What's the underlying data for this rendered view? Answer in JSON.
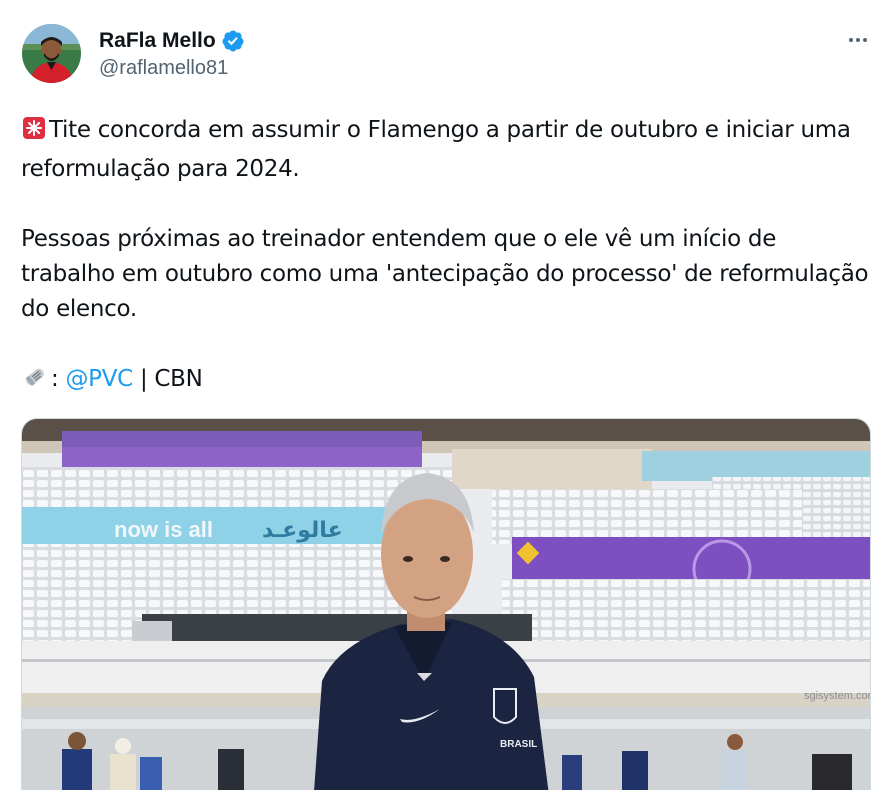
{
  "author": {
    "display_name": "RaFla Mello",
    "handle": "@raflamello81",
    "verified": true,
    "avatar_icon": "profile-photo",
    "verified_icon": "verified-badge-icon",
    "verified_color": "#1d9bf0"
  },
  "menu": {
    "icon": "more-options-icon"
  },
  "tweet": {
    "para1": "Tite concorda em assumir o Flamengo a partir de outubro e iniciar uma reformulação para 2024.",
    "para2": "Pessoas próximas ao treinador entendem que o ele vê um início de trabalho em outubro como uma 'antecipação do processo' de reformulação do elenco.",
    "source_prefix": ": ",
    "source_mention": "@PVC",
    "source_suffix": " | CBN",
    "siren_icon": "siren-emoji",
    "newspaper_icon": "rolled-newspaper-emoji",
    "mention_color": "#1d9bf0"
  },
  "media": {
    "banner_latin": "now is all",
    "banner_arabic": "عالوعـد",
    "sponsor_text": "sgisystem.com",
    "jacket_text": "BRASIL"
  }
}
